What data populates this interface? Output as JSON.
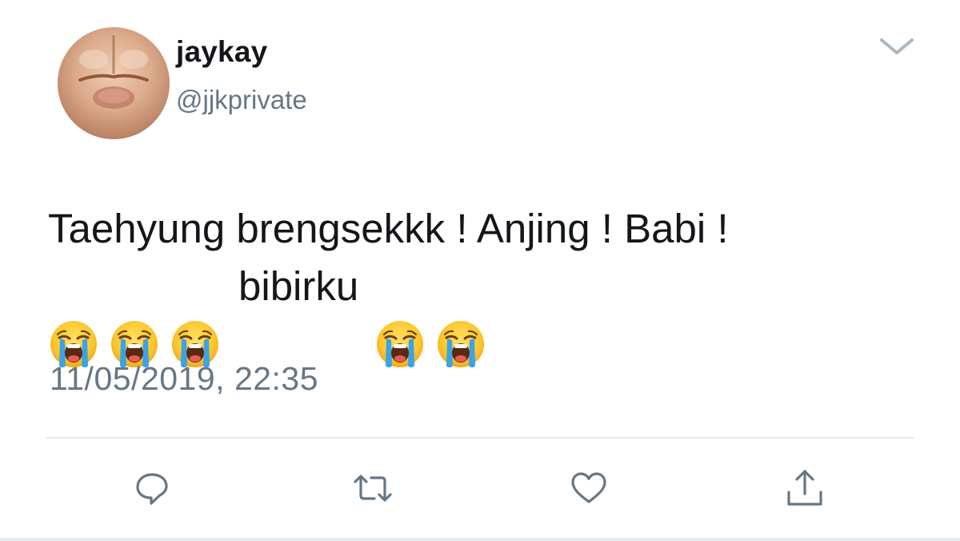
{
  "tweet": {
    "display_name": "jaykay",
    "handle": "@jjkprivate",
    "text_line1": "Taehyung brengsekkk ! Anjing ! Babi !",
    "text_line2_word": "bibirku",
    "emoji": "loudly-crying-face",
    "timestamp": "11/05/2019, 22:35"
  },
  "actions": {
    "reply_icon": "speech-bubble-icon",
    "retweet_icon": "retweet-arrows-icon",
    "like_icon": "heart-icon",
    "share_icon": "share-upload-icon"
  },
  "colors": {
    "text": "#14171a",
    "secondary": "#657786",
    "icon": "#657786",
    "divider": "#e1e8ed"
  }
}
